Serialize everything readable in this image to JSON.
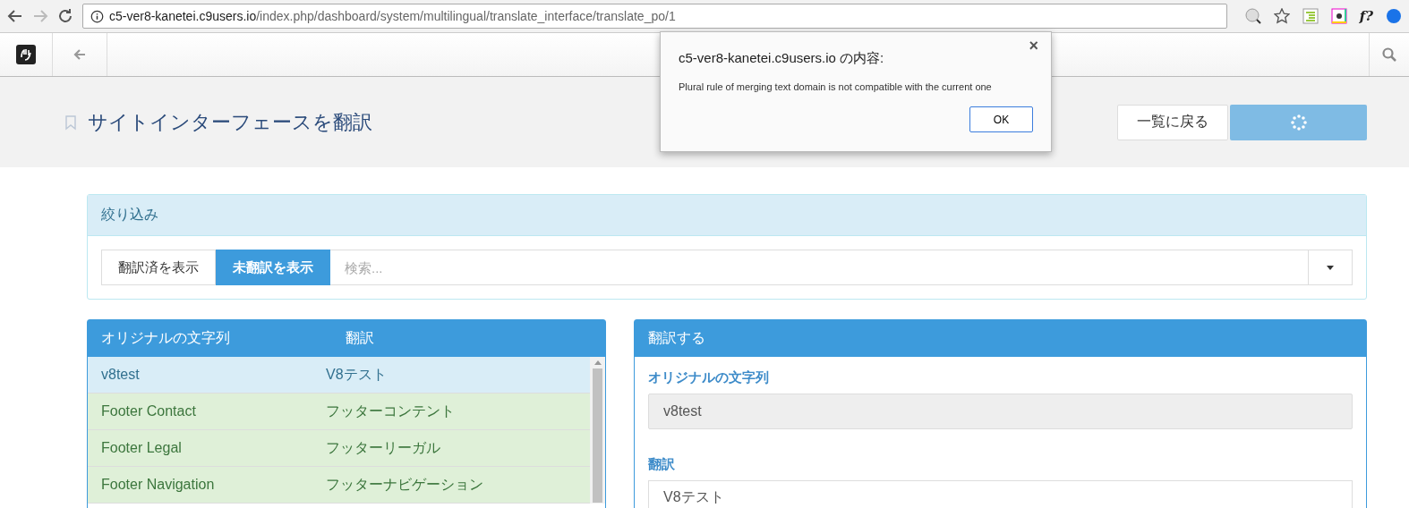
{
  "browser": {
    "url": {
      "host": "c5-ver8-kanetei.c9users.io",
      "path": "/index.php/dashboard/system/multilingual/translate_interface/translate_po/1"
    },
    "extensions": [
      {
        "kind": "ip"
      },
      {
        "kind": "star"
      },
      {
        "kind": "list"
      },
      {
        "kind": "colors"
      },
      {
        "text": "f?",
        "kind": "text"
      },
      {
        "kind": "avatar"
      }
    ]
  },
  "header": {
    "title": "サイトインターフェースを翻訳",
    "back_button": "一覧に戻る",
    "save_busy": true
  },
  "filter": {
    "title": "絞り込み",
    "buttons": [
      {
        "label": "翻訳済を表示",
        "selected": false
      },
      {
        "label": "未翻訳を表示",
        "selected": true
      }
    ],
    "search": {
      "placeholder": "検索..."
    }
  },
  "strings_table": {
    "columns": [
      "オリジナルの文字列",
      "翻訳"
    ],
    "rows": [
      {
        "original": "v8test",
        "translation": "V8テスト",
        "selected": true
      },
      {
        "original": "Footer Contact",
        "translation": "フッターコンテント",
        "selected": false
      },
      {
        "original": "Footer Legal",
        "translation": "フッターリーガル",
        "selected": false
      },
      {
        "original": "Footer Navigation",
        "translation": "フッターナビゲーション",
        "selected": false
      }
    ]
  },
  "translate_panel": {
    "title": "翻訳する",
    "original_label": "オリジナルの文字列",
    "original_value": "v8test",
    "translation_label": "翻訳",
    "translation_value": "V8テスト"
  },
  "dialog": {
    "title": "c5-ver8-kanetei.c9users.io の内容:",
    "message": "Plural rule of merging text domain is not compatible with the current one",
    "close": "×",
    "ok": "OK"
  }
}
